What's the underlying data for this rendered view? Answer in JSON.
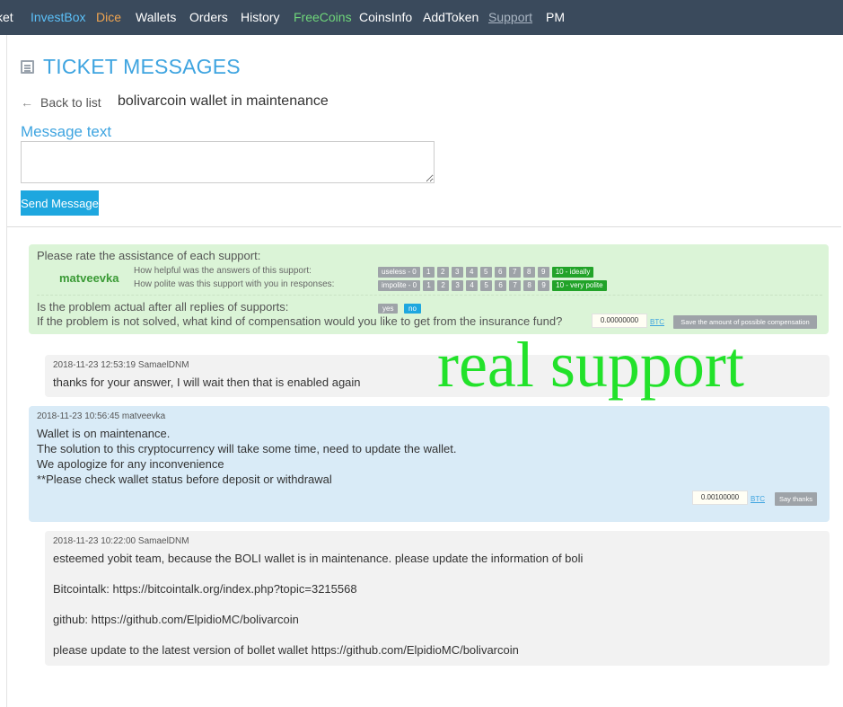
{
  "nav": {
    "items": [
      {
        "label": "ket",
        "style": "white"
      },
      {
        "label": "InvestBox",
        "style": "blue"
      },
      {
        "label": "Dice",
        "style": "orange"
      },
      {
        "label": "Wallets",
        "style": "white"
      },
      {
        "label": "Orders",
        "style": "white"
      },
      {
        "label": "History",
        "style": "white"
      },
      {
        "label": "FreeCoins",
        "style": "green"
      },
      {
        "label": "CoinsInfo",
        "style": "white"
      },
      {
        "label": "AddToken",
        "style": "white"
      },
      {
        "label": "Support",
        "style": "muted"
      },
      {
        "label": "PM",
        "style": "white"
      }
    ]
  },
  "page": {
    "title": "TICKET MESSAGES",
    "back_label": "Back to list",
    "subject": "bolivarcoin wallet in maintenance",
    "message_label": "Message text",
    "send_label": "Send Message"
  },
  "rating": {
    "prompt": "Please rate the assistance of each support:",
    "support_name": "matveevka",
    "helpful_q": "How helpful was the answers of this support:",
    "polite_q": "How polite was this support with you in responses:",
    "helpful_chips": [
      "useless - 0",
      "1",
      "2",
      "3",
      "4",
      "5",
      "6",
      "7",
      "8",
      "9",
      "10 - ideally"
    ],
    "polite_chips": [
      "impolite - 0",
      "1",
      "2",
      "3",
      "4",
      "5",
      "6",
      "7",
      "8",
      "9",
      "10 - very polite"
    ],
    "actual_q": "Is the problem actual after all replies of supports:",
    "yes_label": "yes",
    "no_label": "no",
    "comp_q": "If the problem is not solved, what kind of compensation would you like to get from the insurance fund?",
    "comp_amount": "0.00000000",
    "comp_currency": "BTC",
    "comp_button": "Save the amount of possible compensation"
  },
  "messages": [
    {
      "meta": "2018-11-23 12:53:19 SamaelDNM",
      "lines": [
        "thanks for your answer, I will wait then that is enabled again"
      ]
    },
    {
      "meta": "2018-11-23 10:56:45 matveevka",
      "lines": [
        "Wallet  is on maintenance.",
        "The solution to this cryptocurrency will take some time, need to update the wallet.",
        "We apologize for any inconvenience",
        "**Please  check wallet status before deposit or withdrawal"
      ],
      "thanks_amount": "0.00100000",
      "thanks_currency": "BTC",
      "thanks_button": "Say thanks"
    },
    {
      "meta": "2018-11-23 10:22:00 SamaelDNM",
      "lines": [
        "esteemed yobit team, because the BOLI wallet is in maintenance. please update the information of boli",
        "Bitcointalk: https://bitcointalk.org/index.php?topic=3215568",
        "github: https://github.com/ElpidioMC/bolivarcoin",
        "please update to the latest version of bollet wallet https://github.com/ElpidioMC/bolivarcoin"
      ]
    }
  ],
  "overlay": "real support",
  "colors": {
    "nav_bg": "#3a4a5c",
    "accent_blue": "#3ea4e0",
    "rate_bg": "#dbf4d7",
    "staff_msg_bg": "#d9ebf7",
    "user_msg_bg": "#f2f2f2",
    "overlay_green": "#22e22a"
  }
}
